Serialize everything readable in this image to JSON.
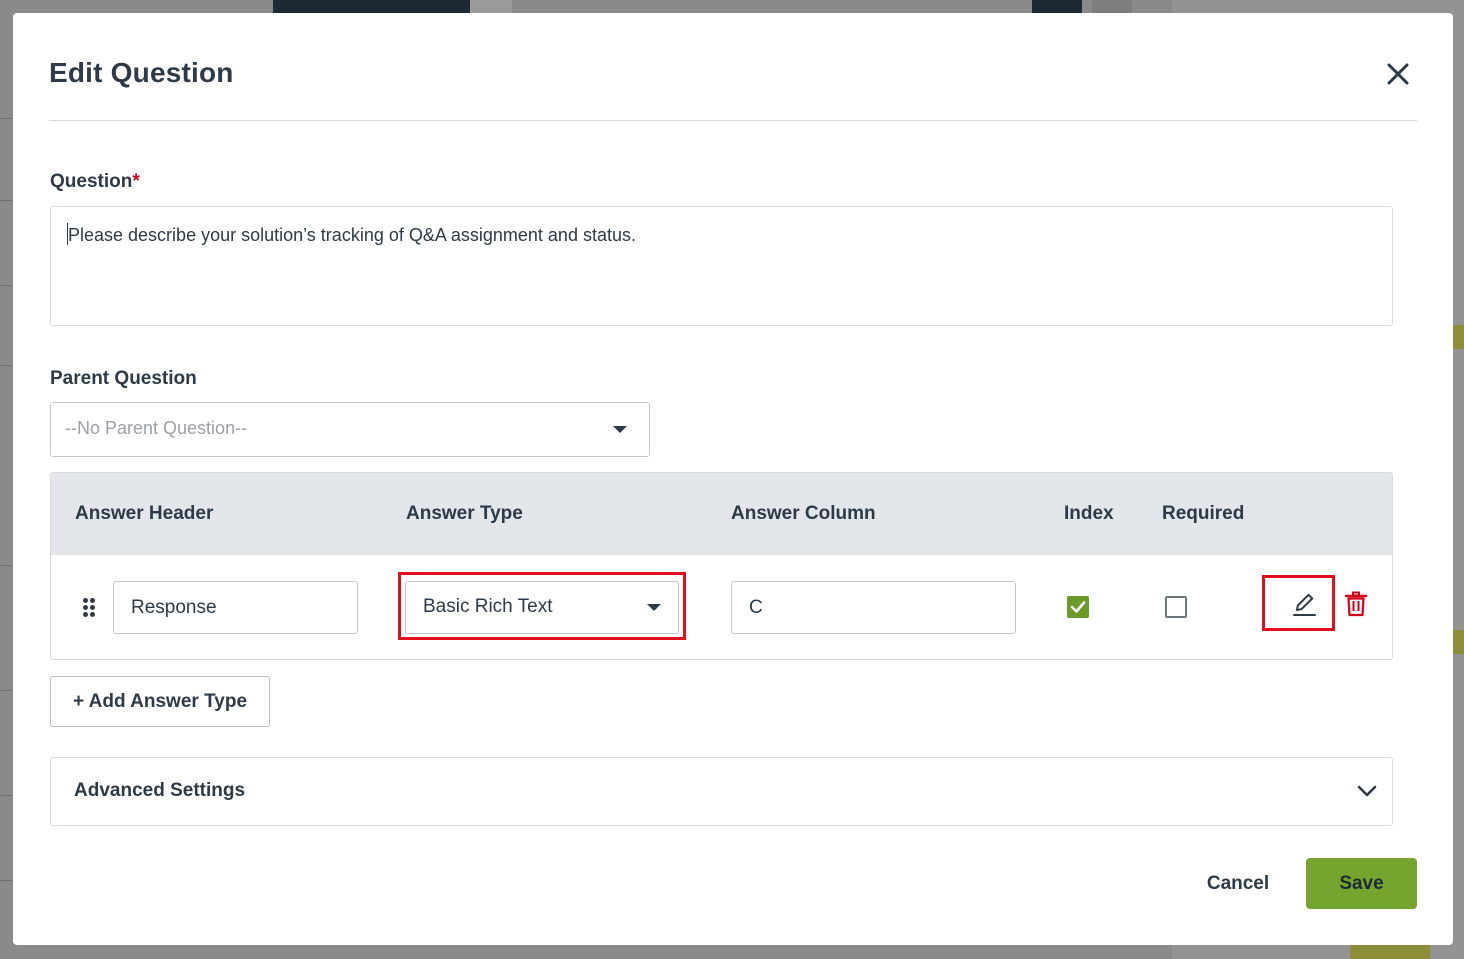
{
  "modal": {
    "title": "Edit Question",
    "close_icon": "close-icon"
  },
  "question": {
    "label": "Question",
    "required_mark": "*",
    "value": "Please describe your solution’s tracking of Q&A assignment and status."
  },
  "parent_question": {
    "label": "Parent Question",
    "selected": "--No Parent Question--"
  },
  "answers_table": {
    "headers": [
      "Answer Header",
      "Answer Type",
      "Answer Column",
      "Index",
      "Required"
    ],
    "rows": [
      {
        "answer_header": "Response",
        "answer_type": "Basic Rich Text",
        "answer_column": "C",
        "index": true,
        "required": false
      }
    ]
  },
  "add_answer_type_label": "+ Add Answer Type",
  "advanced_settings_label": "Advanced Settings",
  "footer": {
    "cancel_label": "Cancel",
    "save_label": "Save"
  },
  "colors": {
    "accent_green": "#75a52e",
    "checkbox_green": "#6a9a27",
    "highlight_red": "#e0101e",
    "delete_red": "#d0021b",
    "text_dark": "#2e3a48"
  }
}
